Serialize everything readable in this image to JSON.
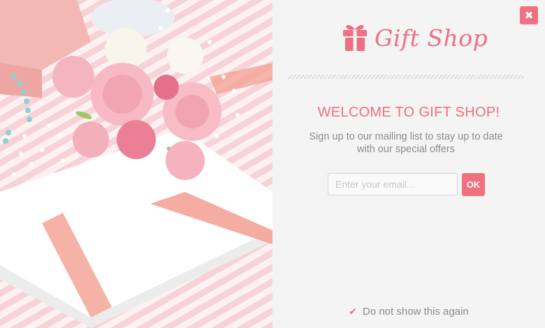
{
  "popup": {
    "close_icon": "close-icon",
    "close_glyph": "✖",
    "logo_icon": "gift-icon",
    "logo_text": "Gift Shop",
    "headline": "WELCOME TO GIFT SHOP!",
    "subtext": "Sign up to our mailing list to stay up to date with our special offers",
    "email": {
      "placeholder": "Enter your email...",
      "value": ""
    },
    "ok_label": "OK",
    "dont_show": {
      "check_glyph": "✔",
      "label": "Do not show this again"
    }
  },
  "photo": {
    "description_icon": "bouquet-gift-photo"
  },
  "colors": {
    "accent": "#f1707f",
    "heading": "#ef6f7f",
    "panel_bg": "#f4f4f4",
    "text_muted": "#8c8c8c"
  }
}
